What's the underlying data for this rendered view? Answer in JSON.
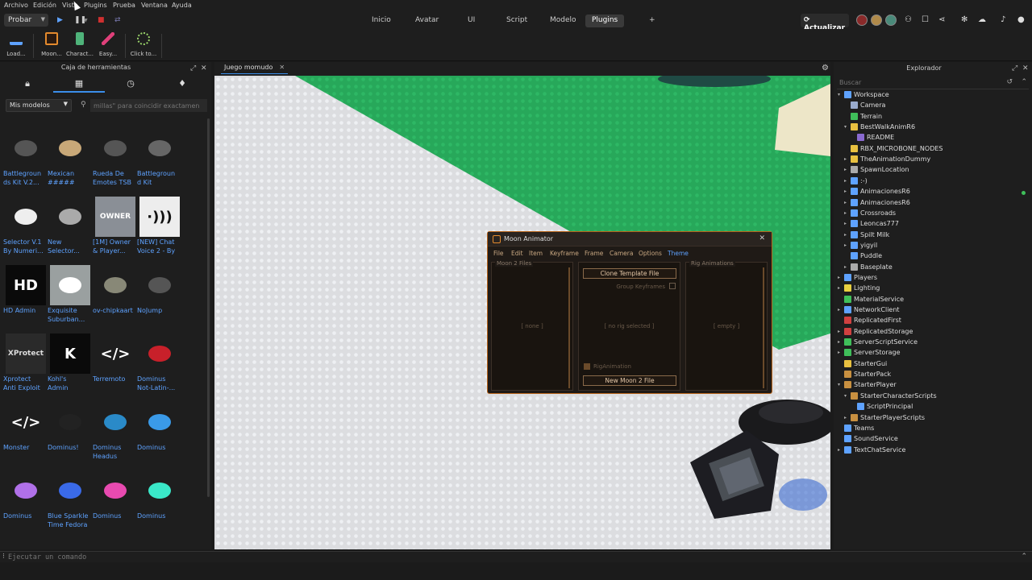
{
  "menubar": {
    "items": [
      "Archivo",
      "Edición",
      "Vista",
      "Plugins",
      "Prueba",
      "Ventana",
      "Ayuda"
    ]
  },
  "toolbar": {
    "mode": "Probar",
    "tabs": [
      "Inicio",
      "Avatar",
      "UI",
      "Script",
      "Modelo",
      "Plugins",
      "+"
    ],
    "active_tab": "Plugins",
    "update_label": "Actualizar"
  },
  "plugins": [
    {
      "label": "Load...",
      "icon": "load-icon",
      "color": "#5ea2ff"
    },
    {
      "label": "Moon...",
      "icon": "moon-animator-icon",
      "color": "#e38a2d"
    },
    {
      "label": "Charact...",
      "icon": "character-icon",
      "color": "#4fb37a"
    },
    {
      "label": "Easy...",
      "icon": "easy-style-icon",
      "color": "#e0407a"
    },
    {
      "label": "Click to...",
      "icon": "click-to-icon",
      "color": "#9ad46a"
    }
  ],
  "toolbox": {
    "title": "Caja de herramientas",
    "category": "Mis modelos",
    "search_placeholder": "millas\" para coincidir exactamen",
    "items": [
      {
        "name": "Battlegroun\nds Kit V.2...",
        "thumb_text": "",
        "bg": "#1e1e1e",
        "fg": "#555"
      },
      {
        "name": "Mexican\n#####",
        "thumb_text": "",
        "bg": "#1e1e1e",
        "fg": "#c8a878"
      },
      {
        "name": "Rueda De\nEmotes TSB",
        "thumb_text": "",
        "bg": "#1e1e1e",
        "fg": "#555"
      },
      {
        "name": "Battlegroun\nd Kit",
        "thumb_text": "",
        "bg": "#1e1e1e",
        "fg": "#666"
      },
      {
        "name": "Selector V.1\nBy Numeri...",
        "thumb_text": "",
        "bg": "#1e1e1e",
        "fg": "#eee"
      },
      {
        "name": "New\nSelector...",
        "thumb_text": "",
        "bg": "#1e1e1e",
        "fg": "#aaa"
      },
      {
        "name": "[1M] Owner\n& Player...",
        "thumb_text": "OWNER",
        "bg": "#8a8f96",
        "fg": "#fff"
      },
      {
        "name": "[NEW] Chat\nVoice 2 - By",
        "thumb_text": "·)))",
        "bg": "#ededed",
        "fg": "#111"
      },
      {
        "name": "HD Admin",
        "thumb_text": "HD",
        "bg": "#0a0a0a",
        "fg": "#fff"
      },
      {
        "name": "Exquisite\nSuburban...",
        "thumb_text": "",
        "bg": "#9aa0a0",
        "fg": "#fff"
      },
      {
        "name": "ov-chipkaart",
        "thumb_text": "",
        "bg": "#1e1e1e",
        "fg": "#887"
      },
      {
        "name": "NoJump",
        "thumb_text": "",
        "bg": "#1e1e1e",
        "fg": "#555"
      },
      {
        "name": "Xprotect\nAnti Exploit",
        "thumb_text": "XProtect",
        "bg": "#2a2a2a",
        "fg": "#ddd"
      },
      {
        "name": "Kohl's\nAdmin",
        "thumb_text": "K",
        "bg": "#0a0a0a",
        "fg": "#fff"
      },
      {
        "name": "Terremoto",
        "thumb_text": "</>",
        "bg": "#1e1e1e",
        "fg": "#fff"
      },
      {
        "name": "Dominus\nNot-Latin-...",
        "thumb_text": "",
        "bg": "#1e1e1e",
        "fg": "#c8202a"
      },
      {
        "name": "Monster",
        "thumb_text": "</>",
        "bg": "#1e1e1e",
        "fg": "#fff"
      },
      {
        "name": "Dominus!",
        "thumb_text": "",
        "bg": "#1e1e1e",
        "fg": "#222"
      },
      {
        "name": "Dominus\nHeadus",
        "thumb_text": "",
        "bg": "#1e1e1e",
        "fg": "#2a8ac8"
      },
      {
        "name": "Dominus",
        "thumb_text": "",
        "bg": "#1e1e1e",
        "fg": "#3a9ae8"
      },
      {
        "name": "Dominus",
        "thumb_text": "",
        "bg": "#1e1e1e",
        "fg": "#b070e8"
      },
      {
        "name": "Blue Sparkle\nTime Fedora",
        "thumb_text": "",
        "bg": "#1e1e1e",
        "fg": "#3a6ae8"
      },
      {
        "name": "Dominus",
        "thumb_text": "",
        "bg": "#1e1e1e",
        "fg": "#e84ab0"
      },
      {
        "name": "Dominus",
        "thumb_text": "",
        "bg": "#1e1e1e",
        "fg": "#3ae8c8"
      }
    ]
  },
  "viewport": {
    "tab_title": "Juego momudo"
  },
  "moon_animator": {
    "title": "Moon Animator",
    "menu": [
      "File",
      "Edit",
      "Item",
      "Keyframe",
      "Frame",
      "Camera",
      "Options",
      "Theme"
    ],
    "active_menu": "Theme",
    "files_header": "Moon 2 Files",
    "files_placeholder": "[    none    ]",
    "clone_button": "Clone Template File",
    "group_keyframes": "Group Keyframes",
    "rig_placeholder": "[    no rig selected    ]",
    "rig_animation_label": "RigAnimation",
    "new_file_button": "New Moon 2 File",
    "rig_header": "Rig Animations",
    "rig_empty": "[    empty    ]",
    "accent": "#e38a2d"
  },
  "explorer": {
    "title": "Explorador",
    "search_placeholder": "Buscar",
    "tree": [
      {
        "label": "Workspace",
        "depth": 0,
        "arrow": "▾",
        "color": "#5ea2ff"
      },
      {
        "label": "Camera",
        "depth": 1,
        "arrow": "",
        "color": "#9ac"
      },
      {
        "label": "Terrain",
        "depth": 1,
        "arrow": "",
        "color": "#3fbf5a"
      },
      {
        "label": "BestWalkAnimR6",
        "depth": 1,
        "arrow": "▾",
        "color": "#e8c040"
      },
      {
        "label": "README",
        "depth": 2,
        "arrow": "",
        "color": "#8a6ad0"
      },
      {
        "label": "RBX_MICROBONE_NODES",
        "depth": 1,
        "arrow": "",
        "color": "#e8c040"
      },
      {
        "label": "TheAnimationDummy",
        "depth": 1,
        "arrow": "▸",
        "color": "#e8c040"
      },
      {
        "label": "SpawnLocation",
        "depth": 1,
        "arrow": "▸",
        "color": "#aaa"
      },
      {
        "label": ":-)",
        "depth": 1,
        "arrow": "▸",
        "color": "#5ea2ff"
      },
      {
        "label": "AnimacionesR6",
        "depth": 1,
        "arrow": "▸",
        "color": "#5ea2ff"
      },
      {
        "label": "AnimacionesR6",
        "depth": 1,
        "arrow": "▸",
        "color": "#5ea2ff"
      },
      {
        "label": "Crossroads",
        "depth": 1,
        "arrow": "▸",
        "color": "#5ea2ff"
      },
      {
        "label": "Leoncas777",
        "depth": 1,
        "arrow": "▸",
        "color": "#5ea2ff"
      },
      {
        "label": "Spilt Milk",
        "depth": 1,
        "arrow": "▸",
        "color": "#5ea2ff"
      },
      {
        "label": "yigyil",
        "depth": 1,
        "arrow": "▸",
        "color": "#5ea2ff"
      },
      {
        "label": "Puddle",
        "depth": 1,
        "arrow": "",
        "color": "#5ea2ff"
      },
      {
        "label": "Baseplate",
        "depth": 1,
        "arrow": "▸",
        "color": "#aaa"
      },
      {
        "label": "Players",
        "depth": 0,
        "arrow": "▸",
        "color": "#5ea2ff"
      },
      {
        "label": "Lighting",
        "depth": 0,
        "arrow": "▸",
        "color": "#e8d040"
      },
      {
        "label": "MaterialService",
        "depth": 0,
        "arrow": "",
        "color": "#3fbf5a"
      },
      {
        "label": "NetworkClient",
        "depth": 0,
        "arrow": "▸",
        "color": "#5ea2ff"
      },
      {
        "label": "ReplicatedFirst",
        "depth": 0,
        "arrow": "",
        "color": "#d04040"
      },
      {
        "label": "ReplicatedStorage",
        "depth": 0,
        "arrow": "▸",
        "color": "#d04040"
      },
      {
        "label": "ServerScriptService",
        "depth": 0,
        "arrow": "▸",
        "color": "#3fbf5a"
      },
      {
        "label": "ServerStorage",
        "depth": 0,
        "arrow": "▸",
        "color": "#3fbf5a"
      },
      {
        "label": "StarterGui",
        "depth": 0,
        "arrow": "",
        "color": "#e8c040"
      },
      {
        "label": "StarterPack",
        "depth": 0,
        "arrow": "",
        "color": "#c89040"
      },
      {
        "label": "StarterPlayer",
        "depth": 0,
        "arrow": "▾",
        "color": "#c89040"
      },
      {
        "label": "StarterCharacterScripts",
        "depth": 1,
        "arrow": "▾",
        "color": "#c89040"
      },
      {
        "label": "ScriptPrincipal",
        "depth": 2,
        "arrow": "",
        "color": "#5ea2ff"
      },
      {
        "label": "StarterPlayerScripts",
        "depth": 1,
        "arrow": "▸",
        "color": "#c89040"
      },
      {
        "label": "Teams",
        "depth": 0,
        "arrow": "",
        "color": "#5ea2ff"
      },
      {
        "label": "SoundService",
        "depth": 0,
        "arrow": "",
        "color": "#5ea2ff"
      },
      {
        "label": "TextChatService",
        "depth": 0,
        "arrow": "▸",
        "color": "#5ea2ff"
      }
    ]
  },
  "command_bar": {
    "placeholder": "Ejecutar un comando"
  }
}
